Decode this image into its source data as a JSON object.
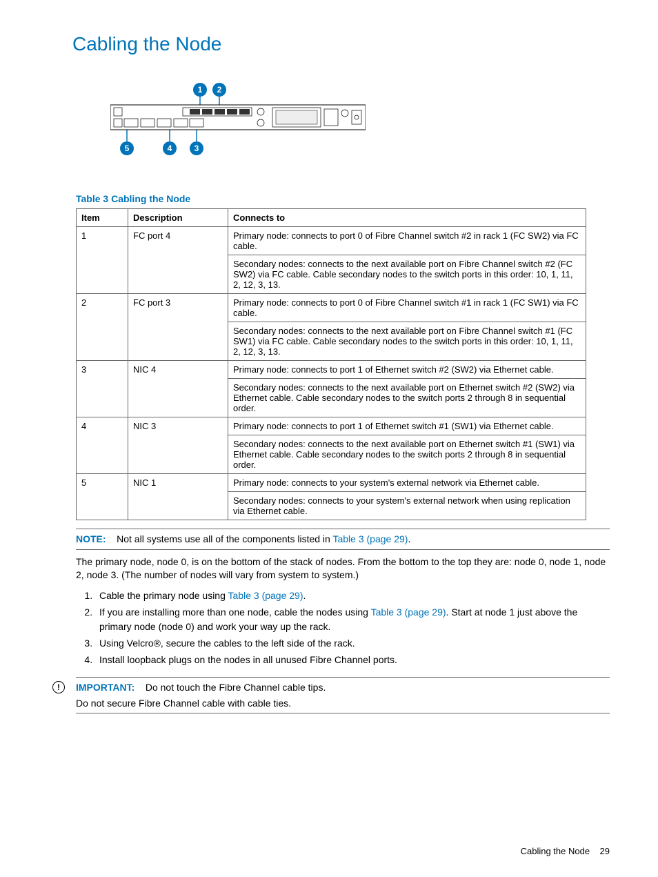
{
  "page_title": "Cabling the Node",
  "diagram": {
    "callouts": [
      "1",
      "2",
      "3",
      "4",
      "5"
    ]
  },
  "table": {
    "title": "Table 3 Cabling the Node",
    "headers": {
      "item": "Item",
      "description": "Description",
      "connects_to": "Connects to"
    },
    "rows": [
      {
        "item": "1",
        "description": "FC port 4",
        "connects_to": [
          "Primary node: connects to port 0 of Fibre Channel switch #2 in rack 1 (FC SW2) via FC cable.",
          "Secondary nodes: connects to the next available port on Fibre Channel switch #2 (FC SW2) via FC cable. Cable secondary nodes to the switch ports in this order: 10, 1, 11, 2, 12, 3, 13."
        ]
      },
      {
        "item": "2",
        "description": "FC port 3",
        "connects_to": [
          "Primary node: connects to port 0 of Fibre Channel switch #1 in rack 1 (FC SW1) via FC cable.",
          "Secondary nodes: connects to the next available port on Fibre Channel switch #1 (FC SW1) via FC cable. Cable secondary nodes to the switch ports in this order: 10, 1, 11, 2, 12, 3, 13."
        ]
      },
      {
        "item": "3",
        "description": "NIC 4",
        "connects_to": [
          "Primary node: connects to port 1 of Ethernet switch #2 (SW2) via Ethernet cable.",
          "Secondary nodes: connects to the next available port on Ethernet switch #2 (SW2) via Ethernet cable. Cable secondary nodes to the switch ports 2 through 8 in sequential order."
        ]
      },
      {
        "item": "4",
        "description": "NIC 3",
        "connects_to": [
          "Primary node: connects to port 1 of Ethernet switch #1 (SW1) via Ethernet cable.",
          "Secondary nodes: connects to the next available port on Ethernet switch #1 (SW1) via Ethernet cable. Cable secondary nodes to the switch ports 2 through 8 in sequential order."
        ]
      },
      {
        "item": "5",
        "description": "NIC 1",
        "connects_to": [
          "Primary node: connects to your system's external network via Ethernet cable.",
          "Secondary nodes: connects to your system's external network when using replication via Ethernet cable."
        ]
      }
    ]
  },
  "note": {
    "label": "NOTE:",
    "text_before_link": "Not all systems use all of the components listed in ",
    "link_text": "Table 3 (page 29)",
    "text_after_link": "."
  },
  "body_paragraph": "The primary node, node 0, is on the bottom of the stack of nodes. From the bottom to the top they are: node 0, node 1, node 2, node 3. (The number of nodes will vary from system to system.)",
  "steps": [
    {
      "fragments": [
        "Cable the primary node using ",
        "Table 3 (page 29)",
        "."
      ]
    },
    {
      "fragments": [
        "If you are installing more than one node, cable the nodes using ",
        "Table 3 (page 29)",
        ". Start at node 1 just above the primary node (node 0) and work your way up the rack."
      ]
    },
    {
      "fragments": [
        "Using Velcro®, secure the cables to the left side of the rack."
      ]
    },
    {
      "fragments": [
        "Install loopback plugs on the nodes in all unused Fibre Channel ports."
      ]
    }
  ],
  "important": {
    "label": "IMPORTANT:",
    "line1": "Do not touch the Fibre Channel cable tips.",
    "line2": "Do not secure Fibre Channel cable with cable ties."
  },
  "footer": {
    "section": "Cabling the Node",
    "page_num": "29"
  }
}
